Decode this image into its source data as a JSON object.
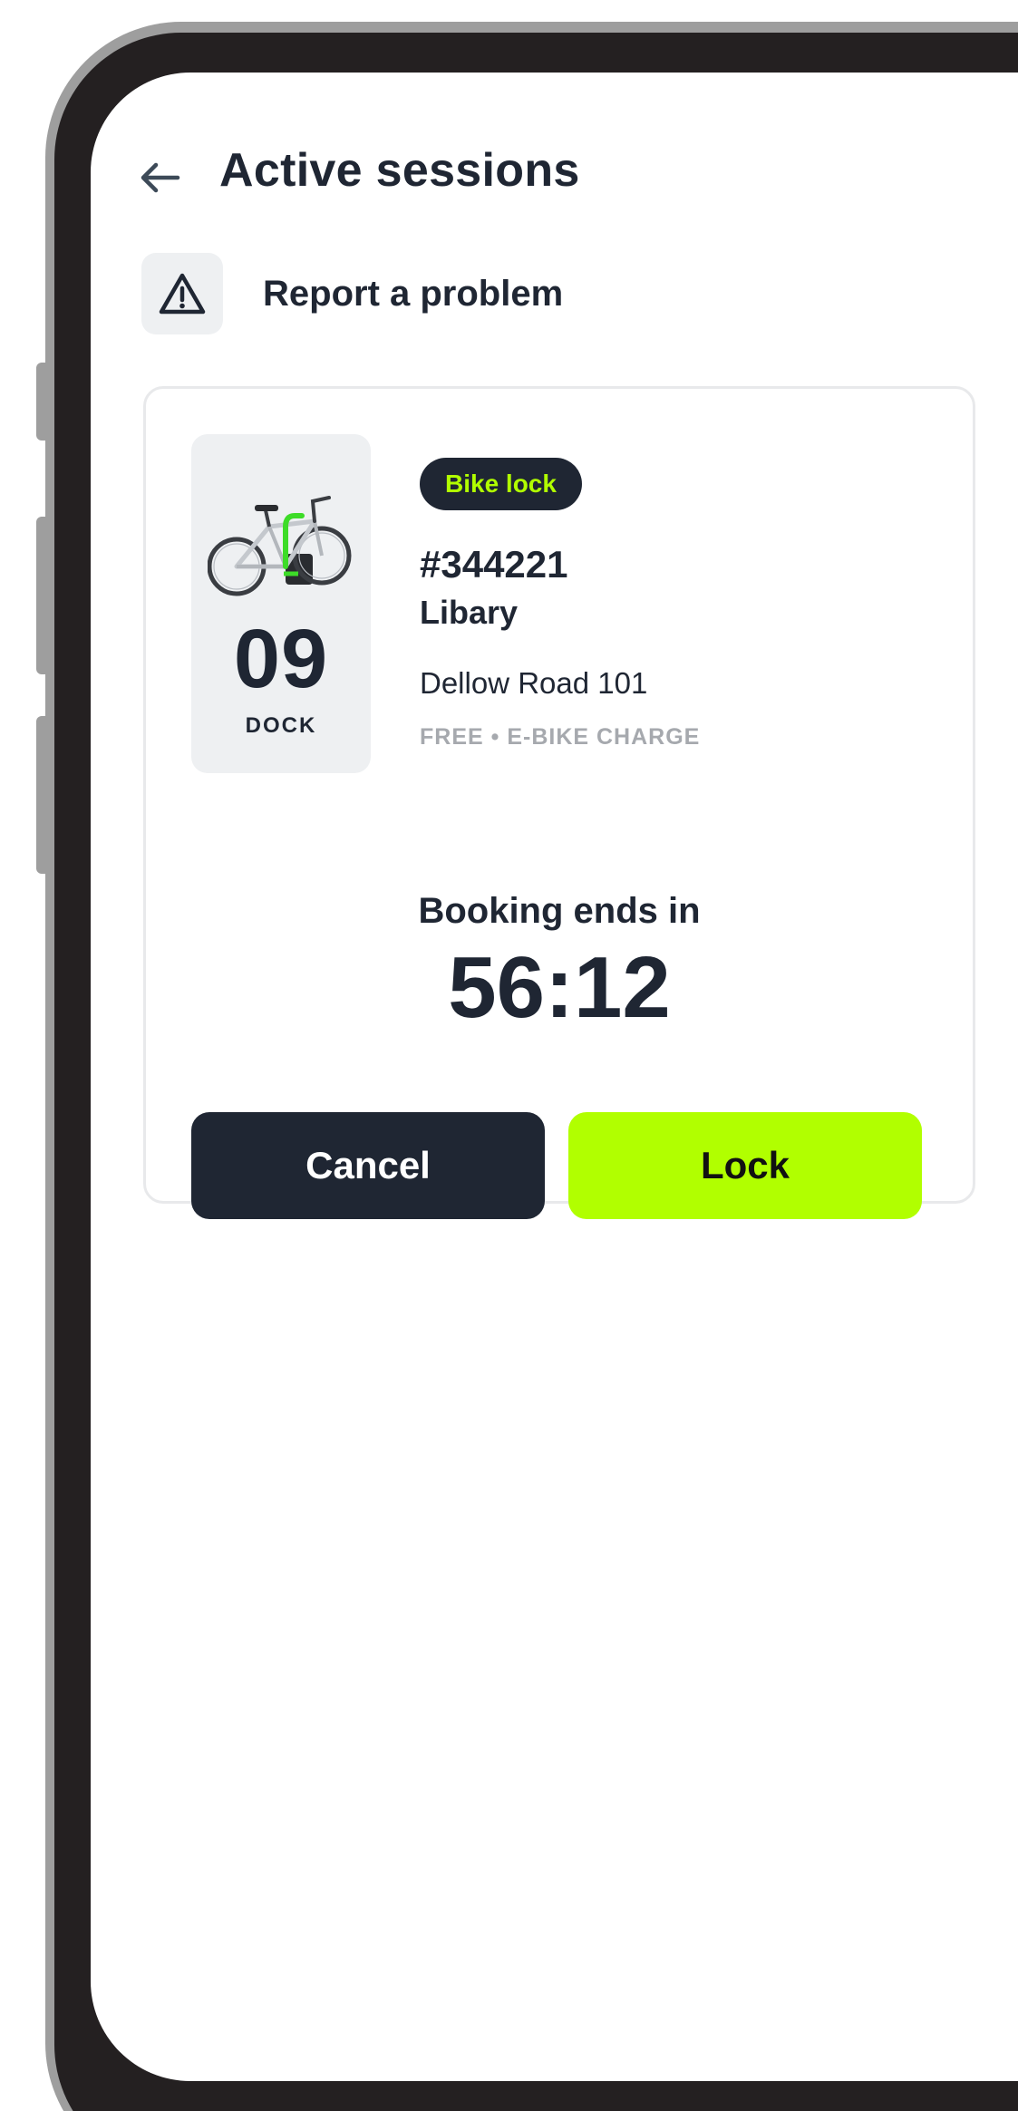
{
  "header": {
    "title": "Active sessions",
    "back_icon": "arrow-left-icon"
  },
  "report": {
    "label": "Report a problem",
    "icon": "warning-triangle-icon"
  },
  "session": {
    "dock_number": "09",
    "dock_label": "DOCK",
    "type_badge": "Bike lock",
    "lock_id": "#344221",
    "lock_name": "Libary",
    "address": "Dellow Road 101",
    "features": "FREE • E-BIKE CHARGE",
    "booking_label": "Booking ends in",
    "timer": "56:12",
    "cancel_label": "Cancel",
    "lock_label": "Lock"
  },
  "colors": {
    "accent": "#b1ff00",
    "dark": "#1f2633",
    "muted": "#a6a9ae",
    "panel": "#eef0f2"
  }
}
